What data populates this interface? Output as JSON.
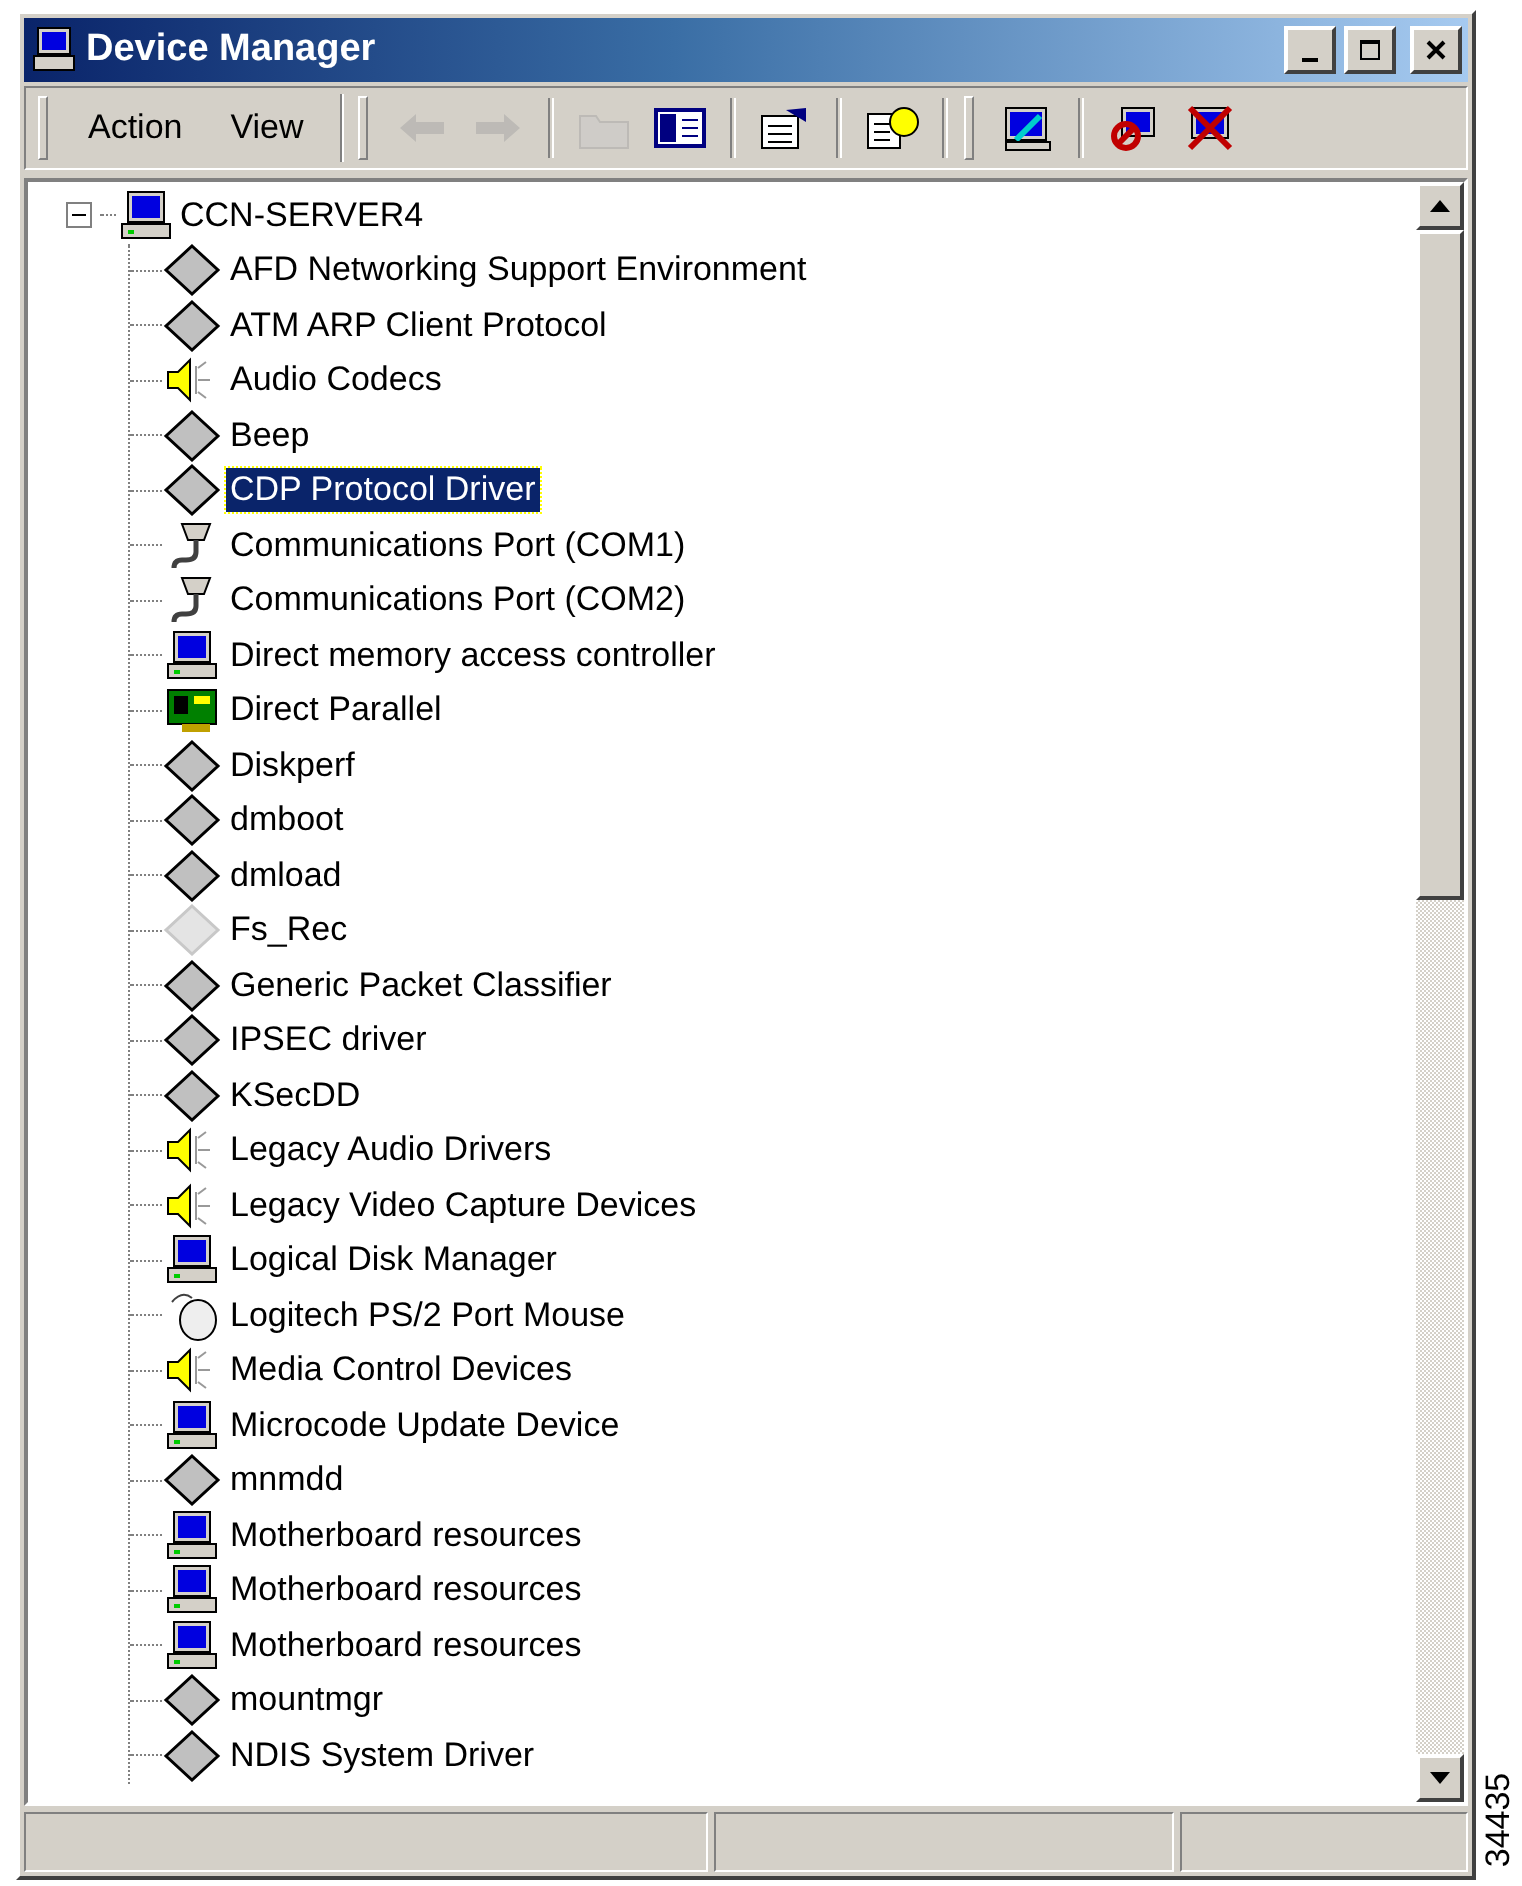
{
  "window": {
    "title": "Device Manager"
  },
  "menus": [
    {
      "label": "Action"
    },
    {
      "label": "View"
    }
  ],
  "toolbar": [
    {
      "kind": "back",
      "disabled": true
    },
    {
      "kind": "forward",
      "disabled": true
    },
    {
      "kind": "sep"
    },
    {
      "kind": "up",
      "disabled": true
    },
    {
      "kind": "tree",
      "disabled": false
    },
    {
      "kind": "sep"
    },
    {
      "kind": "properties",
      "disabled": false
    },
    {
      "kind": "sep"
    },
    {
      "kind": "help",
      "disabled": false
    },
    {
      "kind": "grip"
    },
    {
      "kind": "scan",
      "disabled": false
    },
    {
      "kind": "sep"
    },
    {
      "kind": "disable",
      "disabled": false
    },
    {
      "kind": "uninstall",
      "disabled": false
    }
  ],
  "tree": {
    "label": "CCN-SERVER4",
    "expanded": true,
    "children": [
      {
        "label": "AFD Networking Support Environment",
        "kind": "diamond",
        "selected": false
      },
      {
        "label": "ATM ARP Client Protocol",
        "kind": "diamond",
        "selected": false
      },
      {
        "label": "Audio Codecs",
        "kind": "speaker",
        "selected": false
      },
      {
        "label": "Beep",
        "kind": "diamond",
        "selected": false
      },
      {
        "label": "CDP Protocol Driver",
        "kind": "diamond",
        "selected": true
      },
      {
        "label": "Communications Port (COM1)",
        "kind": "port",
        "selected": false
      },
      {
        "label": "Communications Port (COM2)",
        "kind": "port",
        "selected": false
      },
      {
        "label": "Direct memory access controller",
        "kind": "computer",
        "selected": false
      },
      {
        "label": "Direct Parallel",
        "kind": "card",
        "selected": false
      },
      {
        "label": "Diskperf",
        "kind": "diamond",
        "selected": false
      },
      {
        "label": "dmboot",
        "kind": "diamond",
        "selected": false
      },
      {
        "label": "dmload",
        "kind": "diamond",
        "selected": false
      },
      {
        "label": "Fs_Rec",
        "kind": "faded",
        "selected": false
      },
      {
        "label": "Generic Packet Classifier",
        "kind": "diamond",
        "selected": false
      },
      {
        "label": "IPSEC driver",
        "kind": "diamond",
        "selected": false
      },
      {
        "label": "KSecDD",
        "kind": "diamond",
        "selected": false
      },
      {
        "label": "Legacy Audio Drivers",
        "kind": "speaker",
        "selected": false
      },
      {
        "label": "Legacy Video Capture Devices",
        "kind": "speaker",
        "selected": false
      },
      {
        "label": "Logical Disk Manager",
        "kind": "computer",
        "selected": false
      },
      {
        "label": "Logitech PS/2 Port Mouse",
        "kind": "mouse",
        "selected": false
      },
      {
        "label": "Media Control Devices",
        "kind": "speaker",
        "selected": false
      },
      {
        "label": "Microcode Update Device",
        "kind": "computer",
        "selected": false
      },
      {
        "label": "mnmdd",
        "kind": "diamond",
        "selected": false
      },
      {
        "label": "Motherboard resources",
        "kind": "computer",
        "selected": false
      },
      {
        "label": "Motherboard resources",
        "kind": "computer",
        "selected": false
      },
      {
        "label": "Motherboard resources",
        "kind": "computer",
        "selected": false
      },
      {
        "label": "mountmgr",
        "kind": "diamond",
        "selected": false
      },
      {
        "label": "NDIS System Driver",
        "kind": "diamond",
        "selected": false
      }
    ]
  },
  "figure_number": "34435"
}
